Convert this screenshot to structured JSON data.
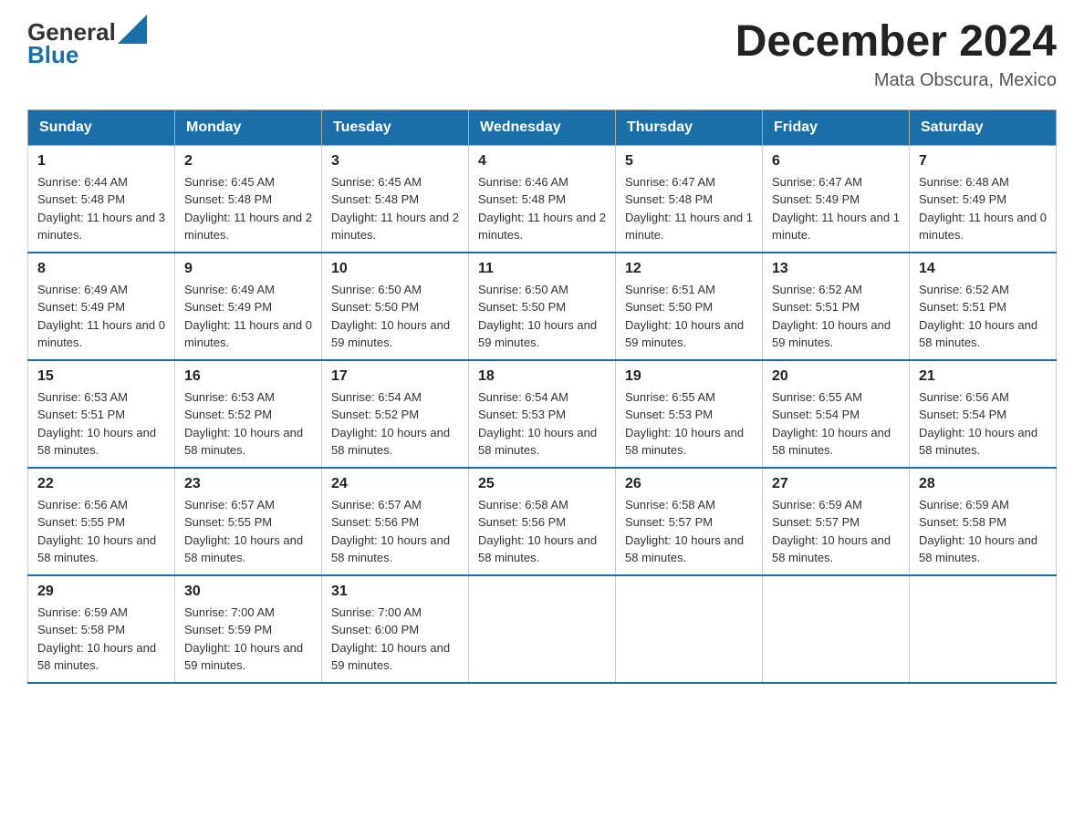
{
  "header": {
    "logo_line1": "General",
    "logo_line2": "Blue",
    "month_title": "December 2024",
    "location": "Mata Obscura, Mexico"
  },
  "weekdays": [
    "Sunday",
    "Monday",
    "Tuesday",
    "Wednesday",
    "Thursday",
    "Friday",
    "Saturday"
  ],
  "weeks": [
    [
      {
        "day": "1",
        "sunrise": "6:44 AM",
        "sunset": "5:48 PM",
        "daylight": "11 hours and 3 minutes."
      },
      {
        "day": "2",
        "sunrise": "6:45 AM",
        "sunset": "5:48 PM",
        "daylight": "11 hours and 2 minutes."
      },
      {
        "day": "3",
        "sunrise": "6:45 AM",
        "sunset": "5:48 PM",
        "daylight": "11 hours and 2 minutes."
      },
      {
        "day": "4",
        "sunrise": "6:46 AM",
        "sunset": "5:48 PM",
        "daylight": "11 hours and 2 minutes."
      },
      {
        "day": "5",
        "sunrise": "6:47 AM",
        "sunset": "5:48 PM",
        "daylight": "11 hours and 1 minute."
      },
      {
        "day": "6",
        "sunrise": "6:47 AM",
        "sunset": "5:49 PM",
        "daylight": "11 hours and 1 minute."
      },
      {
        "day": "7",
        "sunrise": "6:48 AM",
        "sunset": "5:49 PM",
        "daylight": "11 hours and 0 minutes."
      }
    ],
    [
      {
        "day": "8",
        "sunrise": "6:49 AM",
        "sunset": "5:49 PM",
        "daylight": "11 hours and 0 minutes."
      },
      {
        "day": "9",
        "sunrise": "6:49 AM",
        "sunset": "5:49 PM",
        "daylight": "11 hours and 0 minutes."
      },
      {
        "day": "10",
        "sunrise": "6:50 AM",
        "sunset": "5:50 PM",
        "daylight": "10 hours and 59 minutes."
      },
      {
        "day": "11",
        "sunrise": "6:50 AM",
        "sunset": "5:50 PM",
        "daylight": "10 hours and 59 minutes."
      },
      {
        "day": "12",
        "sunrise": "6:51 AM",
        "sunset": "5:50 PM",
        "daylight": "10 hours and 59 minutes."
      },
      {
        "day": "13",
        "sunrise": "6:52 AM",
        "sunset": "5:51 PM",
        "daylight": "10 hours and 59 minutes."
      },
      {
        "day": "14",
        "sunrise": "6:52 AM",
        "sunset": "5:51 PM",
        "daylight": "10 hours and 58 minutes."
      }
    ],
    [
      {
        "day": "15",
        "sunrise": "6:53 AM",
        "sunset": "5:51 PM",
        "daylight": "10 hours and 58 minutes."
      },
      {
        "day": "16",
        "sunrise": "6:53 AM",
        "sunset": "5:52 PM",
        "daylight": "10 hours and 58 minutes."
      },
      {
        "day": "17",
        "sunrise": "6:54 AM",
        "sunset": "5:52 PM",
        "daylight": "10 hours and 58 minutes."
      },
      {
        "day": "18",
        "sunrise": "6:54 AM",
        "sunset": "5:53 PM",
        "daylight": "10 hours and 58 minutes."
      },
      {
        "day": "19",
        "sunrise": "6:55 AM",
        "sunset": "5:53 PM",
        "daylight": "10 hours and 58 minutes."
      },
      {
        "day": "20",
        "sunrise": "6:55 AM",
        "sunset": "5:54 PM",
        "daylight": "10 hours and 58 minutes."
      },
      {
        "day": "21",
        "sunrise": "6:56 AM",
        "sunset": "5:54 PM",
        "daylight": "10 hours and 58 minutes."
      }
    ],
    [
      {
        "day": "22",
        "sunrise": "6:56 AM",
        "sunset": "5:55 PM",
        "daylight": "10 hours and 58 minutes."
      },
      {
        "day": "23",
        "sunrise": "6:57 AM",
        "sunset": "5:55 PM",
        "daylight": "10 hours and 58 minutes."
      },
      {
        "day": "24",
        "sunrise": "6:57 AM",
        "sunset": "5:56 PM",
        "daylight": "10 hours and 58 minutes."
      },
      {
        "day": "25",
        "sunrise": "6:58 AM",
        "sunset": "5:56 PM",
        "daylight": "10 hours and 58 minutes."
      },
      {
        "day": "26",
        "sunrise": "6:58 AM",
        "sunset": "5:57 PM",
        "daylight": "10 hours and 58 minutes."
      },
      {
        "day": "27",
        "sunrise": "6:59 AM",
        "sunset": "5:57 PM",
        "daylight": "10 hours and 58 minutes."
      },
      {
        "day": "28",
        "sunrise": "6:59 AM",
        "sunset": "5:58 PM",
        "daylight": "10 hours and 58 minutes."
      }
    ],
    [
      {
        "day": "29",
        "sunrise": "6:59 AM",
        "sunset": "5:58 PM",
        "daylight": "10 hours and 58 minutes."
      },
      {
        "day": "30",
        "sunrise": "7:00 AM",
        "sunset": "5:59 PM",
        "daylight": "10 hours and 59 minutes."
      },
      {
        "day": "31",
        "sunrise": "7:00 AM",
        "sunset": "6:00 PM",
        "daylight": "10 hours and 59 minutes."
      },
      null,
      null,
      null,
      null
    ]
  ]
}
